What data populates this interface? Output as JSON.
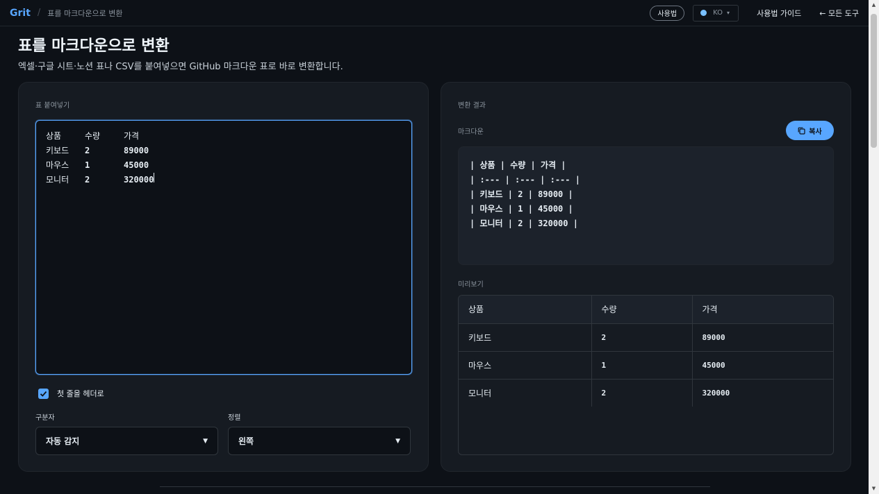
{
  "header": {
    "brand": "Grit",
    "separator": "/",
    "breadcrumb": "표를 마크다운으로 변환",
    "usage_button": "사용법",
    "language": "KO",
    "guide_link": "사용법 가이드",
    "all_tools_link": "← 모든 도구"
  },
  "page": {
    "title": "표를 마크다운으로 변환",
    "description": "엑셀·구글 시트·노션 표나 CSV를 붙여넣으면 GitHub 마크다운 표로 바로 변환합니다."
  },
  "input_panel": {
    "section_label": "표 붙여넣기",
    "rows": [
      [
        "상품",
        "수량",
        "가격"
      ],
      [
        "키보드",
        "2",
        "89000"
      ],
      [
        "마우스",
        "1",
        "45000"
      ],
      [
        "모니터",
        "2",
        "320000"
      ]
    ],
    "header_checkbox_label": "첫 줄을 헤더로",
    "header_checkbox_checked": true,
    "delimiter_label": "구분자",
    "delimiter_value": "자동 감지",
    "align_label": "정렬",
    "align_value": "왼쪽"
  },
  "output_panel": {
    "section_label": "변환 결과",
    "markdown_label": "마크다운",
    "copy_button": "복사",
    "markdown_lines": [
      "| 상품 | 수량 | 가격 |",
      "| :--- | :--- | :--- |",
      "| 키보드 | 2 | 89000 |",
      "| 마우스 | 1 | 45000 |",
      "| 모니터 | 2 | 320000 |"
    ],
    "preview_label": "미리보기",
    "preview_headers": [
      "상품",
      "수량",
      "가격"
    ],
    "preview_rows": [
      [
        "키보드",
        "2",
        "89000"
      ],
      [
        "마우스",
        "1",
        "45000"
      ],
      [
        "모니터",
        "2",
        "320000"
      ]
    ]
  },
  "colors": {
    "accent": "#58a6ff",
    "background": "#0d1117",
    "panel": "#161b22"
  },
  "icons": {
    "globe": "globe-icon",
    "copy": "copy-icon",
    "check": "check-icon",
    "chevron": "chevron-down-icon"
  }
}
